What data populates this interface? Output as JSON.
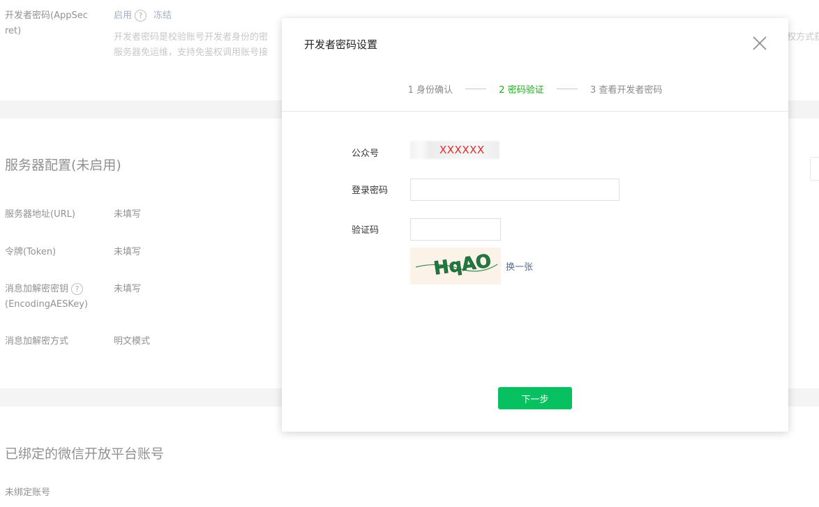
{
  "background": {
    "appsecret": {
      "label_line1": "开发者密码(AppSec",
      "label_line2": "ret)",
      "status_enabled": "启用",
      "freeze_link": "冻结",
      "desc_line1": "开发者密码是校验账号开发者身份的密",
      "desc_line1_tail": "权方式获",
      "desc_line2": "服务器免运维，支持免鉴权调用账号接"
    },
    "server_config": {
      "title": "服务器配置(未启用)",
      "rows": [
        {
          "label": "服务器地址(URL)",
          "value": "未填写"
        },
        {
          "label": "令牌(Token)",
          "value": "未填写"
        },
        {
          "label": "消息加解密密钥",
          "label_line2": "(EncodingAESKey)",
          "value": "未填写"
        },
        {
          "label": "消息加解密方式",
          "value": "明文模式"
        }
      ]
    },
    "open_platform": {
      "title": "已绑定的微信开放平台账号",
      "row_label": "未绑定账号"
    }
  },
  "dialog": {
    "title": "开发者密码设置",
    "steps": [
      {
        "label": "1 身份确认",
        "active": false
      },
      {
        "label": "2 密码验证",
        "active": true
      },
      {
        "label": "3 查看开发者密码",
        "active": false
      }
    ],
    "fields": {
      "account_label": "公众号",
      "account_value": "XXXXXX",
      "password_label": "登录密码",
      "password_value": "",
      "captcha_label": "验证码",
      "captcha_value": "",
      "captcha_text": "HqAO",
      "refresh_link": "换一张"
    },
    "next_button": "下一步"
  },
  "colors": {
    "accent_green": "#07c160",
    "active_step": "#1aad19",
    "link_blue": "#576b95",
    "account_red": "#e02b2b"
  }
}
